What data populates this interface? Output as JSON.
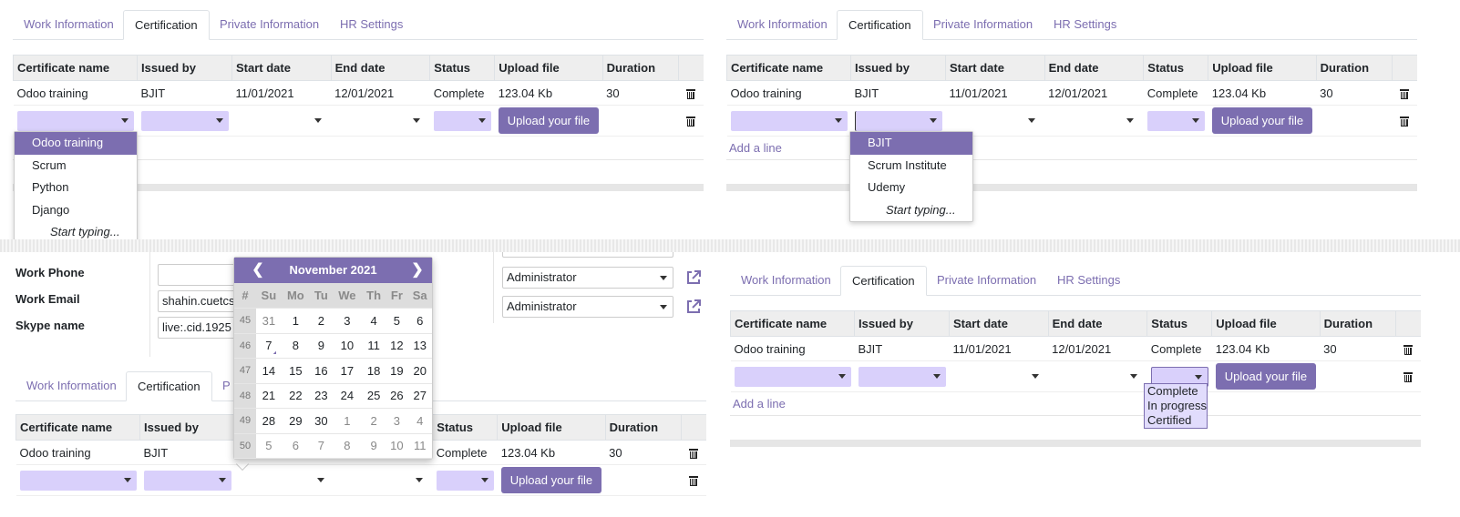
{
  "tabs": [
    "Work Information",
    "Certification",
    "Private Information",
    "HR Settings"
  ],
  "tabs_truncated_p": "P",
  "columns": [
    "Certificate name",
    "Issued by",
    "Start date",
    "End date",
    "Status",
    "Upload file",
    "Duration"
  ],
  "row": {
    "name": "Odoo training",
    "issued": "BJIT",
    "start": "11/01/2021",
    "end": "12/01/2021",
    "status": "Complete",
    "file": "123.04 Kb",
    "duration": "30"
  },
  "upload_label": "Upload your file",
  "add_line": "Add a line",
  "certificate_options": [
    "Odoo training",
    "Scrum",
    "Python",
    "Django"
  ],
  "issuer_options": [
    "BJIT",
    "Scrum Institute",
    "Udemy"
  ],
  "start_typing": "Start typing...",
  "status_options": [
    "Complete",
    "In progress",
    "Certified"
  ],
  "contact": {
    "phone_label": "Work Phone",
    "email_label": "Work Email",
    "skype_label": "Skype name",
    "email_value": "shahin.cuetcs",
    "skype_value": "live:.cid.1925",
    "manager1": "Administrator",
    "manager2": "Administrator"
  },
  "calendar": {
    "month": "November 2021",
    "week_header": "#",
    "days": [
      "Su",
      "Mo",
      "Tu",
      "We",
      "Th",
      "Fr",
      "Sa"
    ],
    "weeks": [
      {
        "wk": "45",
        "d": [
          "31",
          "1",
          "2",
          "3",
          "4",
          "5",
          "6"
        ]
      },
      {
        "wk": "46",
        "d": [
          "7",
          "8",
          "9",
          "10",
          "11",
          "12",
          "13"
        ]
      },
      {
        "wk": "47",
        "d": [
          "14",
          "15",
          "16",
          "17",
          "18",
          "19",
          "20"
        ]
      },
      {
        "wk": "48",
        "d": [
          "21",
          "22",
          "23",
          "24",
          "25",
          "26",
          "27"
        ]
      },
      {
        "wk": "49",
        "d": [
          "28",
          "29",
          "30",
          "1",
          "2",
          "3",
          "4"
        ]
      },
      {
        "wk": "50",
        "d": [
          "5",
          "6",
          "7",
          "8",
          "9",
          "10",
          "11"
        ]
      }
    ],
    "other_month": [
      [
        0
      ],
      [],
      [],
      [],
      [
        3,
        4,
        5,
        6
      ],
      [
        0,
        1,
        2,
        3,
        4,
        5,
        6
      ]
    ],
    "today": "7"
  },
  "accent": "#7c6eb0",
  "field_bg": "#d9d0fb"
}
